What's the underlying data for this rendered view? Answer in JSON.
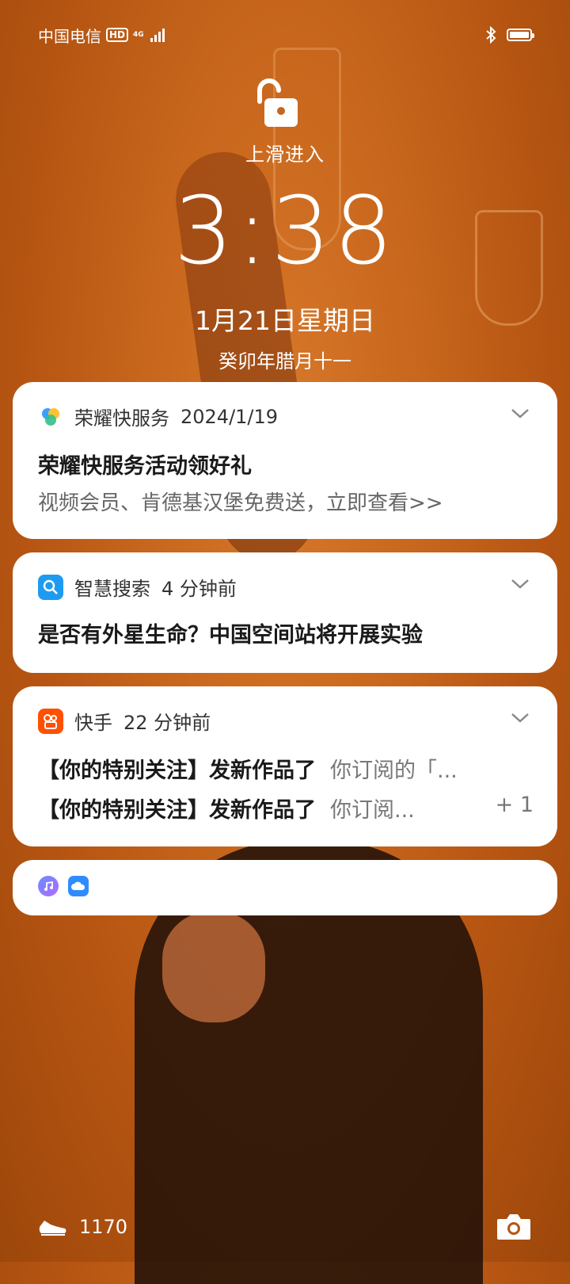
{
  "status_bar": {
    "carrier": "中国电信",
    "hd": "HD",
    "network": "4G"
  },
  "lock": {
    "hint": "上滑进入",
    "time": "3:38",
    "date": "1月21日星期日",
    "lunar": "癸卯年腊月十一"
  },
  "notifications": [
    {
      "app": "荣耀快服务",
      "time": "2024/1/19",
      "title": "荣耀快服务活动领好礼",
      "body": "视频会员、肯德基汉堡免费送，立即查看>>"
    },
    {
      "app": "智慧搜索",
      "time": "4 分钟前",
      "title": "是否有外星生命？中国空间站将开展实验"
    },
    {
      "app": "快手",
      "time": "22 分钟前",
      "rows": [
        {
          "title": "【你的特别关注】发新作品了",
          "snippet": "你订阅的「..."
        },
        {
          "title": "【你的特别关注】发新作品了",
          "snippet": "你订阅...",
          "count": "+ 1"
        }
      ]
    }
  ],
  "bottom": {
    "steps": "1170"
  },
  "colors": {
    "accent_search": "#1e9bf0",
    "accent_kuaishou": "#ff5000"
  }
}
